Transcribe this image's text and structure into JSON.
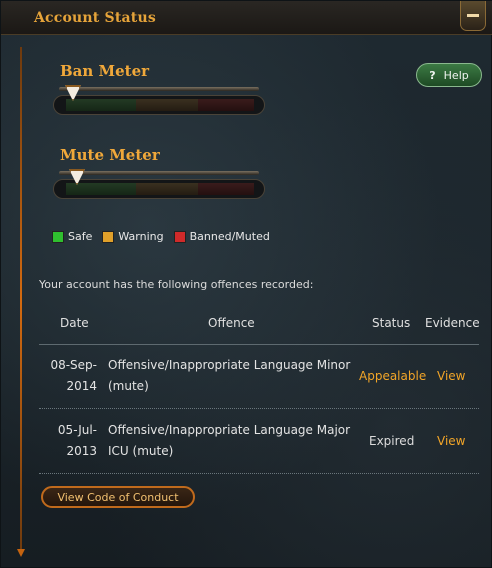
{
  "window": {
    "title": "Account Status"
  },
  "help_label": "Help",
  "ban_meter": {
    "title": "Ban Meter",
    "level": 0.04
  },
  "mute_meter": {
    "title": "Mute Meter",
    "level": 0.06
  },
  "legend": [
    {
      "label": "Safe",
      "color": "#2fbf2f"
    },
    {
      "label": "Warning",
      "color": "#e0a02a"
    },
    {
      "label": "Banned/Muted",
      "color": "#d02a2a"
    }
  ],
  "intro_text": "Your account has the following offences recorded:",
  "table": {
    "headers": {
      "date": "Date",
      "offence": "Offence",
      "status": "Status",
      "evidence": "Evidence"
    },
    "rows": [
      {
        "date_line1": "08-Sep-",
        "date_line2": "2014",
        "offence_line1": "Offensive/Inappropriate Language Minor",
        "offence_line2": "(mute)",
        "status": "Appealable",
        "evidence": "View"
      },
      {
        "date_line1": "05-Jul-",
        "date_line2": "2013",
        "offence_line1": "Offensive/Inappropriate Language Major",
        "offence_line2": "ICU (mute)",
        "status": "Expired",
        "evidence": "View"
      }
    ]
  },
  "code_of_conduct_label": "View Code of Conduct"
}
